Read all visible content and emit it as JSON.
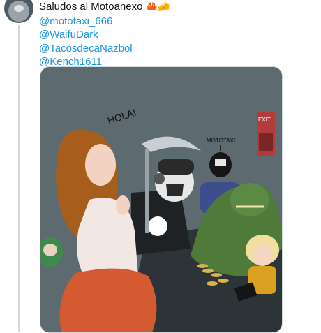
{
  "tweet": {
    "text": "Saludos al Motoanexo",
    "emojis": [
      "crab-emoji",
      "cheese-emoji"
    ],
    "mentions": [
      "@mototaxi_666",
      "@WaifuDark",
      "@TacosdecaNazbol",
      "@Kench1611"
    ]
  },
  "illustration": {
    "speech_text": "HOLA!",
    "sign_text": "EXIT",
    "label_text": "MOTOTAXI"
  },
  "colors": {
    "mention": "#1b95e0",
    "text": "#0f1419",
    "scene_bg": "#5e6b70"
  }
}
